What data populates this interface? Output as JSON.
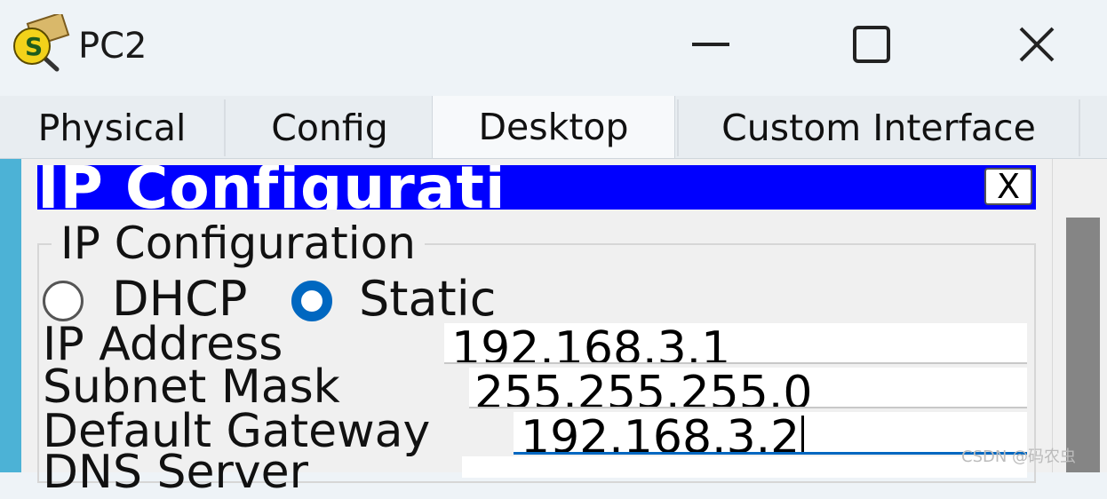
{
  "window": {
    "title": "PC2",
    "icon": "packet-tracer-pc-icon",
    "controls": {
      "minimize": "minimize-icon",
      "maximize": "maximize-icon",
      "close": "close-icon"
    }
  },
  "tabs": [
    {
      "label": "Physical",
      "active": false
    },
    {
      "label": "Config",
      "active": false
    },
    {
      "label": "Desktop",
      "active": true
    },
    {
      "label": "Custom Interface",
      "active": false
    }
  ],
  "ip_panel": {
    "title": "IP Configuratio",
    "close_label": "X",
    "group_label": "IP Configuration",
    "modes": {
      "dhcp": "DHCP",
      "static": "Static",
      "selected": "Static"
    },
    "fields": {
      "ip_address": {
        "label": "IP Address",
        "value": "192.168.3.1"
      },
      "subnet_mask": {
        "label": "Subnet Mask",
        "value": "255.255.255.0"
      },
      "default_gateway": {
        "label": "Default Gateway",
        "value": "192.168.3.2"
      },
      "dns_server": {
        "label": "DNS Server",
        "value": ""
      }
    }
  },
  "watermark": "CSDN @码农虫",
  "colors": {
    "header_blue": "#0000ff",
    "radio_selected": "#0067c0",
    "left_strip": "#4cb2d6",
    "focus_underline": "#0067c0"
  }
}
